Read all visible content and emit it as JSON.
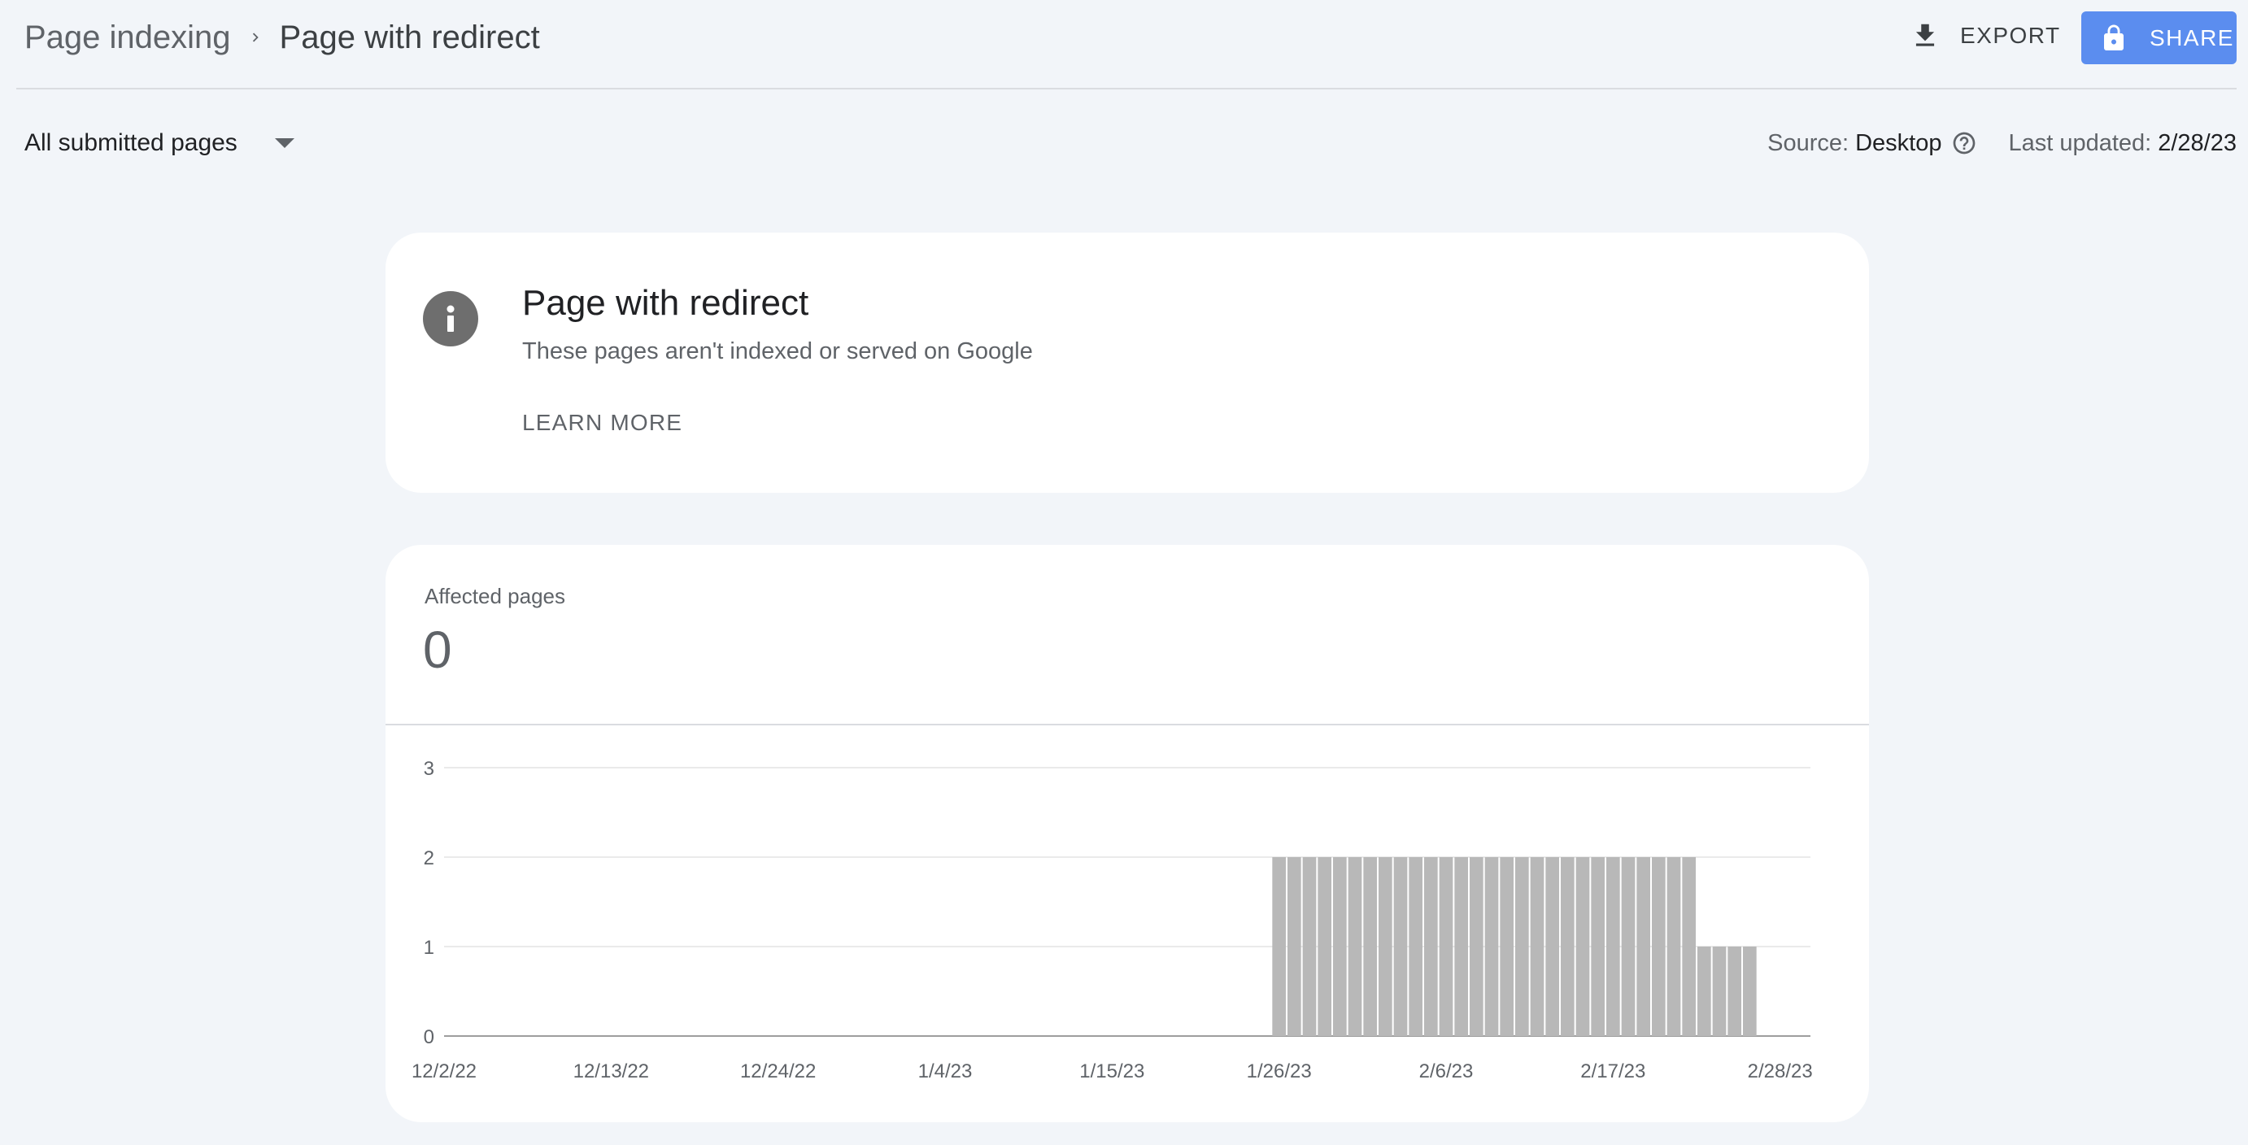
{
  "breadcrumb": {
    "parent": "Page indexing",
    "current": "Page with redirect"
  },
  "toolbar": {
    "export_label": "EXPORT",
    "share_label": "SHARE"
  },
  "filter": {
    "selected": "All submitted pages"
  },
  "meta": {
    "source_label": "Source:",
    "source_value": "Desktop",
    "updated_label": "Last updated:",
    "updated_value": "2/28/23"
  },
  "info_card": {
    "title": "Page with redirect",
    "subtitle": "These pages aren't indexed or served on Google",
    "learn_more": "LEARN MORE"
  },
  "metric": {
    "label": "Affected pages",
    "value": "0"
  },
  "colors": {
    "share_button": "#5b8def",
    "bar": "#b8b8b8",
    "background": "#f2f5f9"
  },
  "icons": {
    "export": "download-icon",
    "share": "lock-icon",
    "info": "info-icon",
    "help": "help-circle-icon",
    "dropdown": "caret-down-icon",
    "breadcrumb_separator": "chevron-right-icon"
  },
  "chart_data": {
    "type": "bar",
    "title": "",
    "xlabel": "",
    "ylabel": "",
    "ylim": [
      0,
      3
    ],
    "yticks": [
      "0",
      "1",
      "2",
      "3"
    ],
    "xticks": [
      "12/2/22",
      "12/13/22",
      "12/24/22",
      "1/4/23",
      "1/15/23",
      "1/26/23",
      "2/6/23",
      "2/17/23",
      "2/28/23"
    ],
    "x": [
      "12/2/22",
      "12/3/22",
      "12/4/22",
      "12/5/22",
      "12/6/22",
      "12/7/22",
      "12/8/22",
      "12/9/22",
      "12/10/22",
      "12/11/22",
      "12/12/22",
      "12/13/22",
      "12/14/22",
      "12/15/22",
      "12/16/22",
      "12/17/22",
      "12/18/22",
      "12/19/22",
      "12/20/22",
      "12/21/22",
      "12/22/22",
      "12/23/22",
      "12/24/22",
      "12/25/22",
      "12/26/22",
      "12/27/22",
      "12/28/22",
      "12/29/22",
      "12/30/22",
      "12/31/22",
      "1/1/23",
      "1/2/23",
      "1/3/23",
      "1/4/23",
      "1/5/23",
      "1/6/23",
      "1/7/23",
      "1/8/23",
      "1/9/23",
      "1/10/23",
      "1/11/23",
      "1/12/23",
      "1/13/23",
      "1/14/23",
      "1/15/23",
      "1/16/23",
      "1/17/23",
      "1/18/23",
      "1/19/23",
      "1/20/23",
      "1/21/23",
      "1/22/23",
      "1/23/23",
      "1/24/23",
      "1/25/23",
      "1/26/23",
      "1/27/23",
      "1/28/23",
      "1/29/23",
      "1/30/23",
      "1/31/23",
      "2/1/23",
      "2/2/23",
      "2/3/23",
      "2/4/23",
      "2/5/23",
      "2/6/23",
      "2/7/23",
      "2/8/23",
      "2/9/23",
      "2/10/23",
      "2/11/23",
      "2/12/23",
      "2/13/23",
      "2/14/23",
      "2/15/23",
      "2/16/23",
      "2/17/23",
      "2/18/23",
      "2/19/23",
      "2/20/23",
      "2/21/23",
      "2/22/23",
      "2/23/23",
      "2/24/23",
      "2/25/23",
      "2/26/23",
      "2/27/23",
      "2/28/23"
    ],
    "values": [
      0,
      0,
      0,
      0,
      0,
      0,
      0,
      0,
      0,
      0,
      0,
      0,
      0,
      0,
      0,
      0,
      0,
      0,
      0,
      0,
      0,
      0,
      0,
      0,
      0,
      0,
      0,
      0,
      0,
      0,
      0,
      0,
      0,
      0,
      0,
      0,
      0,
      0,
      0,
      0,
      0,
      0,
      0,
      0,
      0,
      0,
      0,
      0,
      0,
      0,
      0,
      0,
      0,
      0,
      0,
      2,
      2,
      2,
      2,
      2,
      2,
      2,
      2,
      2,
      2,
      2,
      2,
      2,
      2,
      2,
      2,
      2,
      2,
      2,
      2,
      2,
      2,
      2,
      2,
      2,
      2,
      2,
      2,
      1,
      1,
      1,
      1,
      0,
      0,
      0,
      0
    ],
    "grid": true,
    "legend": "none"
  }
}
